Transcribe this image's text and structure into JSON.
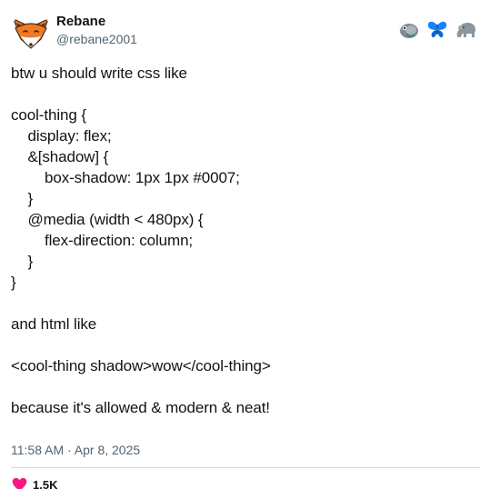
{
  "author": {
    "display_name": "Rebane",
    "handle": "@rebane2001",
    "avatar_icon": "fox-face-icon"
  },
  "platform_icons": [
    "pigeon-icon",
    "butterfly-icon",
    "elephant-icon"
  ],
  "post": {
    "lines": [
      "btw u should write css like",
      "",
      "cool-thing {",
      "    display: flex;",
      "    &[shadow] {",
      "        box-shadow: 1px 1px #0007;",
      "    }",
      "    @media (width < 480px) {",
      "        flex-direction: column;",
      "    }",
      "}",
      "",
      "and html like",
      "",
      "<cool-thing shadow>wow</cool-thing>",
      "",
      "because it's allowed & modern & neat!"
    ],
    "timestamp": "11:58 AM · Apr 8, 2025",
    "likes": "1.5K"
  },
  "colors": {
    "heart": "#f91880",
    "fox_orange": "#f27a24",
    "secondary_text": "#536471"
  }
}
